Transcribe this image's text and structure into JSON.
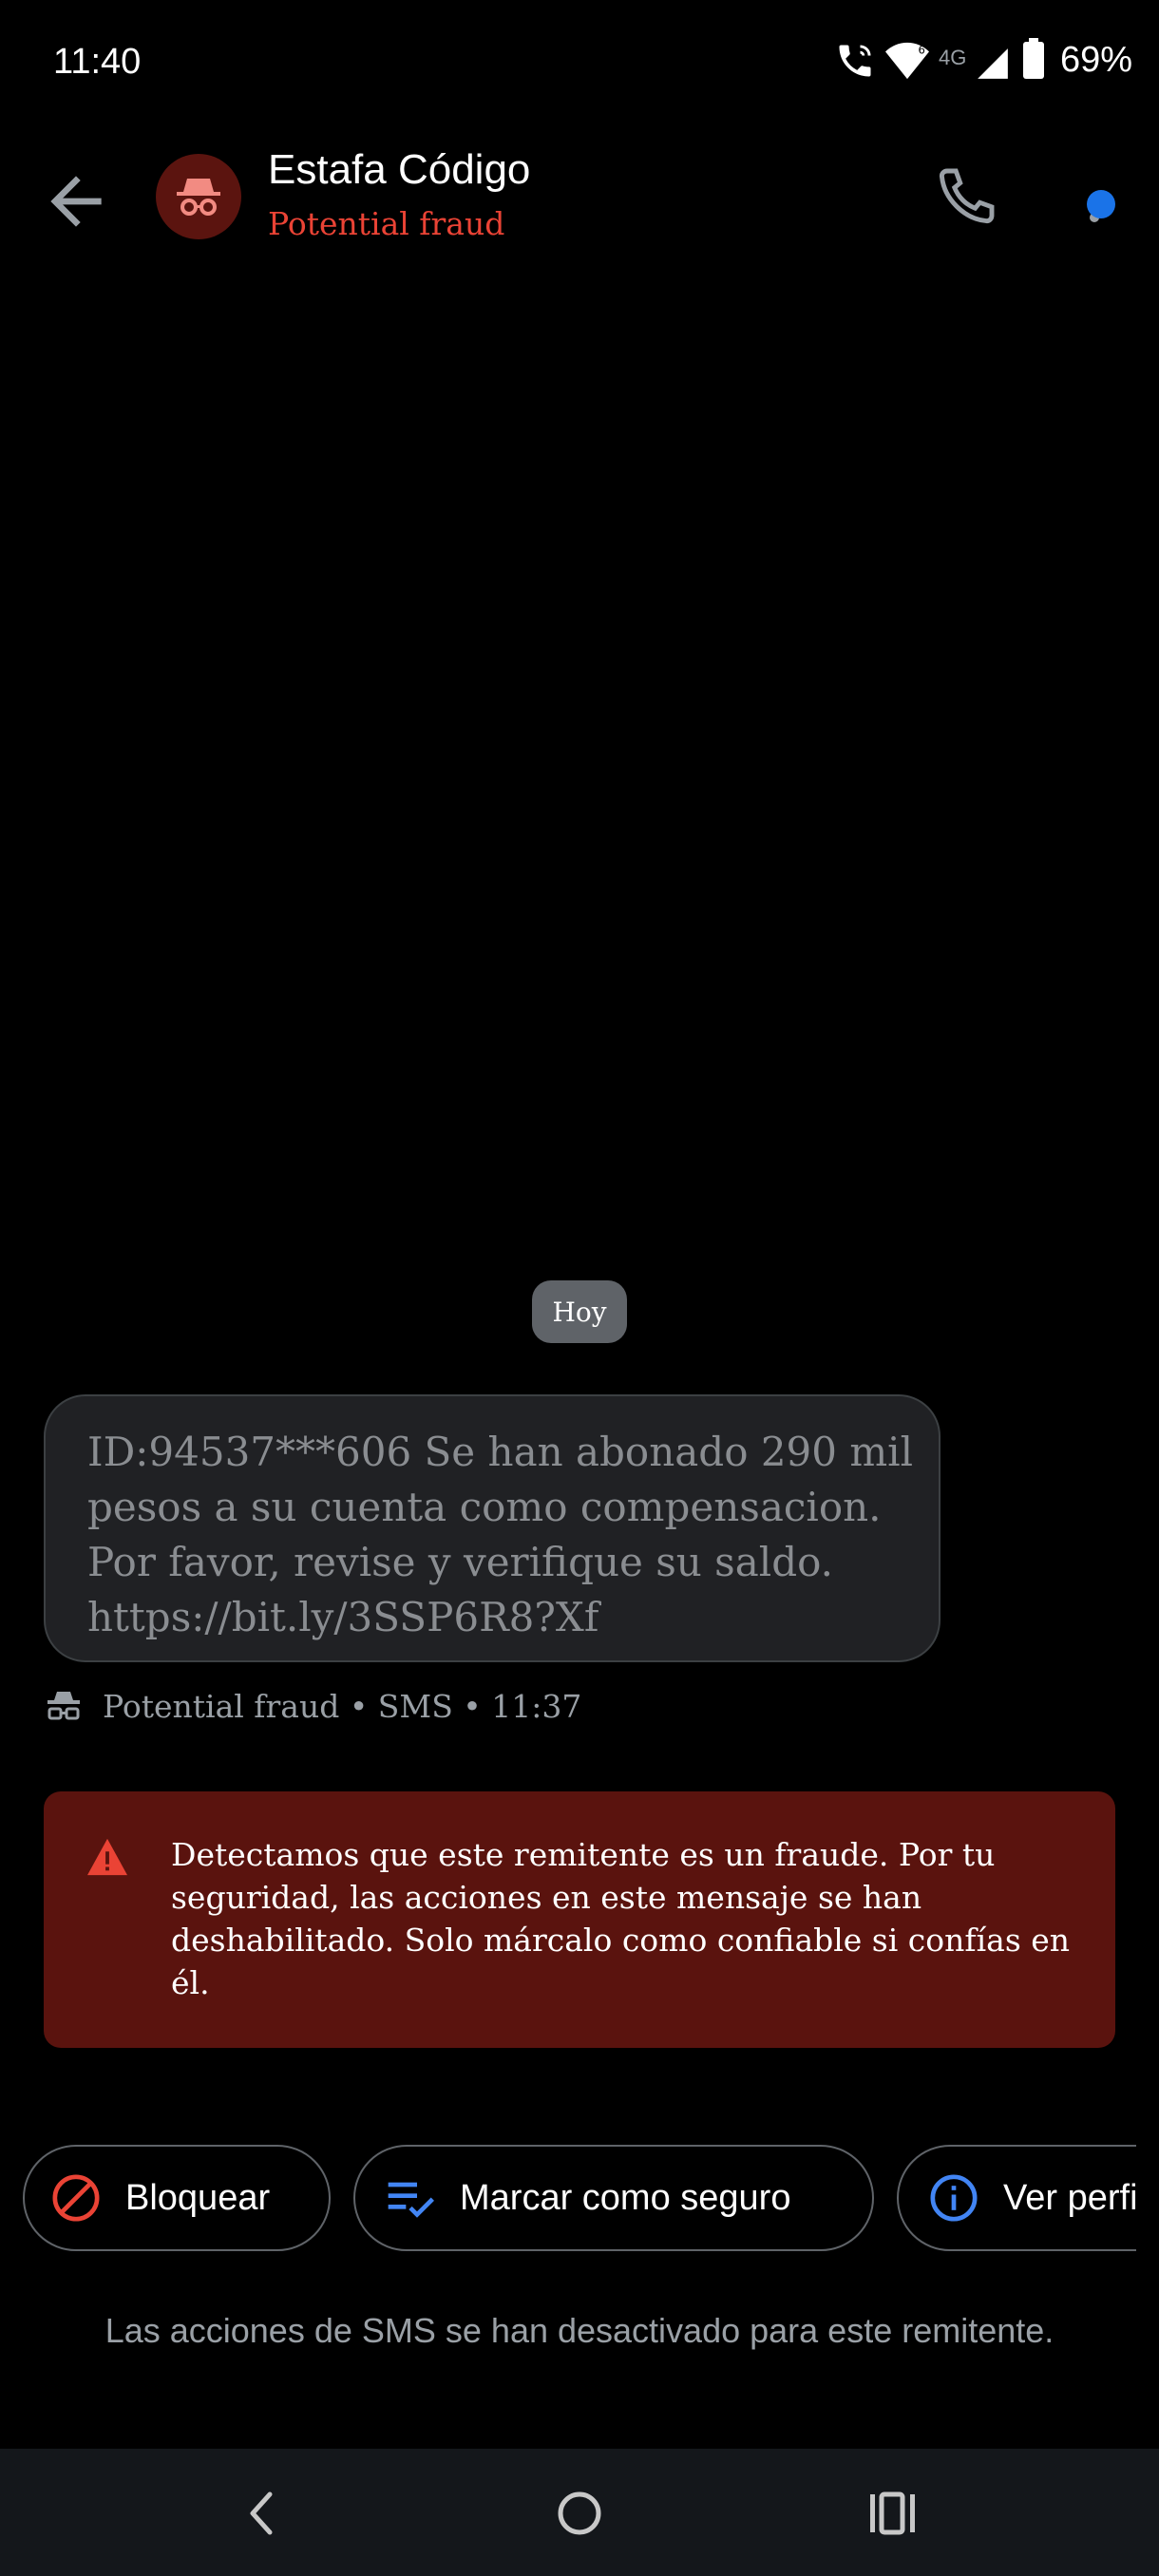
{
  "status_bar": {
    "time": "11:40",
    "battery": "69%",
    "network": "4G",
    "icons": [
      "wifi-calling-icon",
      "wifi-icon",
      "signal-icon",
      "battery-icon"
    ]
  },
  "header": {
    "contact_name": "Estafa Código",
    "contact_status": "Potential fraud",
    "icons": [
      "back-arrow-icon",
      "spy-avatar-icon",
      "phone-icon",
      "more-vert-icon"
    ]
  },
  "conversation": {
    "date_chip": "Hoy",
    "message": {
      "lines": [
        "ID:94537***606  Se han abonado 290 mil",
        "pesos a su cuenta como compensacion.",
        "Por favor, revise y verifique su saldo.",
        "https://bit.ly/3SSP6R8?Xf"
      ],
      "meta": "Potential fraud • SMS • 11:37"
    },
    "warning": {
      "lines": [
        "Detectamos que este remitente es un fraude. Por tu",
        "seguridad, las acciones en este mensaje se han",
        "deshabilitado. Solo márcalo como confiable si confías en",
        "él."
      ]
    }
  },
  "actions": {
    "block": "Bloquear",
    "mark_safe": "Marcar como seguro",
    "view_profile": "Ver perfil"
  },
  "footer_note": "Las acciones de SMS se han desactivado para este remitente.",
  "colors": {
    "fraud_red": "#ea4335",
    "warning_bg": "#5a130e",
    "accent_blue": "#1a73e8",
    "bubble_bg": "#202124"
  }
}
